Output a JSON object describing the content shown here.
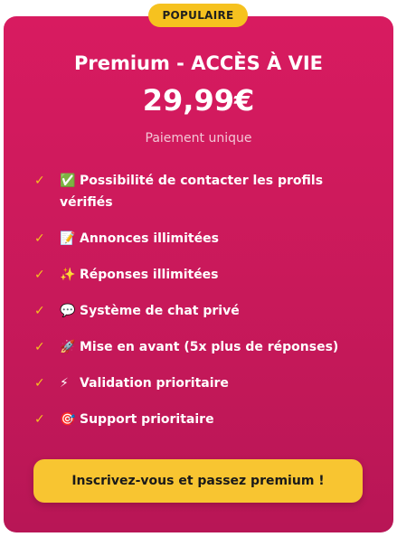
{
  "badge": "POPULAIRE",
  "plan": {
    "title": "Premium - ACCÈS À VIE",
    "price": "29,99€",
    "price_note": "Paiement unique"
  },
  "features": [
    {
      "icon": "check-mark-box-icon",
      "emoji": "✅",
      "text": "Possibilité de contacter les profils vérifiés"
    },
    {
      "icon": "memo-icon",
      "emoji": "📝",
      "text": "Annonces illimitées"
    },
    {
      "icon": "sparkles-icon",
      "emoji": "✨",
      "text": "Réponses illimitées"
    },
    {
      "icon": "speech-bubble-icon",
      "emoji": "💬",
      "text": "Système de chat privé"
    },
    {
      "icon": "rocket-icon",
      "emoji": "🚀",
      "text": "Mise en avant (5x plus de réponses)"
    },
    {
      "icon": "lightning-icon",
      "emoji": "⚡",
      "text": "Validation prioritaire"
    },
    {
      "icon": "target-icon",
      "emoji": "🎯",
      "text": "Support prioritaire"
    }
  ],
  "check_glyph": "✓",
  "cta_label": "Inscrivez-vous et passez premium !",
  "colors": {
    "card": "#d81b60",
    "accent": "#f6c21f",
    "button": "#f8c531"
  }
}
